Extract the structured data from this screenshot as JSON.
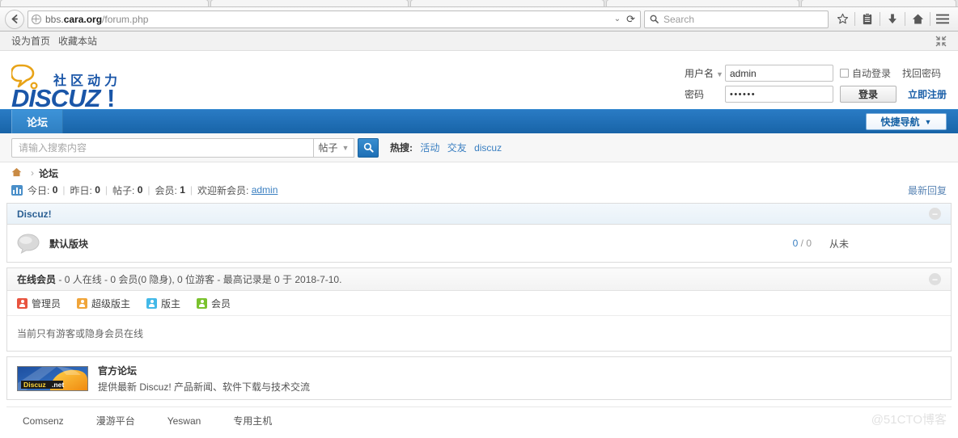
{
  "browser": {
    "back_icon": "back-arrow-icon",
    "url_prefix": "bbs.",
    "url_host": "cara.org",
    "url_path": "/forum.php",
    "url_full": "bbs.cara.org/forum.php",
    "reload_icon": "reload-icon",
    "dropdown_icon": "chevron-down-icon",
    "search_placeholder": "Search",
    "icons": [
      "bookmark-star-icon",
      "library-icon",
      "downloads-icon",
      "home-icon",
      "menu-icon"
    ]
  },
  "topbar": {
    "set_homepage": "设为首页",
    "bookmark_site": "收藏本站",
    "collapse_icon": "collapse-icon"
  },
  "logo": {
    "slogan": "社区动力",
    "wordmark": "DISCUZ!",
    "color": "#1a56a8"
  },
  "login": {
    "username_label": "用户名",
    "username_value": "admin",
    "password_label": "密码",
    "password_value": "••••••",
    "autologin_label": "自动登录",
    "login_button": "登录",
    "forgot_password": "找回密码",
    "register": "立即注册"
  },
  "nav": {
    "tabs": [
      {
        "label": "论坛",
        "active": true
      }
    ],
    "quicknav": "快捷导航",
    "bar_color": "#1d6fb5"
  },
  "search": {
    "placeholder": "请输入搜索内容",
    "type_label": "帖子",
    "button_icon": "search-icon",
    "hot_label": "热搜:",
    "hot_links": [
      "活动",
      "交友",
      "discuz"
    ]
  },
  "breadcrumb": {
    "home_icon": "home-icon",
    "separator": "›",
    "current": "论坛"
  },
  "stats": {
    "chart_icon": "bar-chart-icon",
    "today_label": "今日:",
    "today_value": "0",
    "yesterday_label": "昨日:",
    "yesterday_value": "0",
    "posts_label": "帖子:",
    "posts_value": "0",
    "members_label": "会员:",
    "members_value": "1",
    "welcome_label": "欢迎新会员:",
    "welcome_member": "admin",
    "latest_reply": "最新回复"
  },
  "forum_category": {
    "title": "Discuz!",
    "collapse_icon": "minus-circle-icon",
    "forums": [
      {
        "icon": "forum-bubble-icon",
        "name": "默认版块",
        "threads": "0",
        "separator": "/",
        "posts": "0",
        "lastpost": "从未"
      }
    ]
  },
  "online": {
    "title": "在线会员",
    "summary": "- 0 人在线 - 0 会员(0 隐身), 0 位游客 - 最高记录是 0 于 2018-7-10.",
    "collapse_icon": "minus-circle-icon",
    "legend": [
      {
        "label": "管理员",
        "color": "#e8543f",
        "icon": "user-admin-icon"
      },
      {
        "label": "超级版主",
        "color": "#f0a53a",
        "icon": "user-supermod-icon"
      },
      {
        "label": "版主",
        "color": "#43b9e8",
        "icon": "user-mod-icon"
      },
      {
        "label": "会员",
        "color": "#7ac22e",
        "icon": "user-member-icon"
      }
    ],
    "body_text": "当前只有游客或隐身会员在线"
  },
  "official": {
    "banner_text": "Discuz.net",
    "title": "官方论坛",
    "desc": "提供最新 Discuz! 产品新闻、软件下载与技术交流"
  },
  "footer": {
    "links": [
      "Comsenz",
      "漫游平台",
      "Yeswan",
      "专用主机"
    ],
    "watermark": "@51CTO博客"
  }
}
